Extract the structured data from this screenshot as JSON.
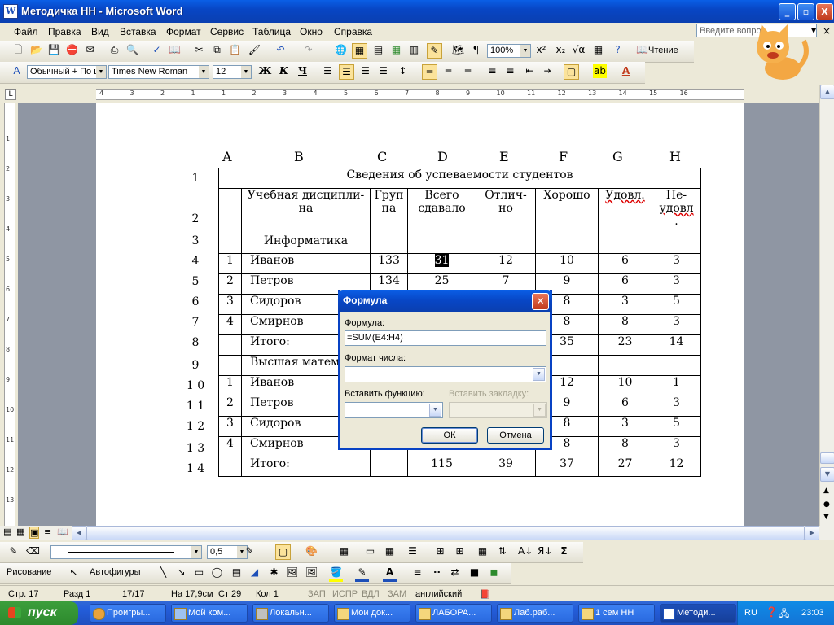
{
  "window": {
    "title": "Методичка НН - Microsoft Word",
    "min": "_",
    "max": "▫",
    "close": "X"
  },
  "menu": [
    "Файл",
    "Правка",
    "Вид",
    "Вставка",
    "Формат",
    "Сервис",
    "Таблица",
    "Окно",
    "Справка"
  ],
  "ask_placeholder": "Введите вопрос",
  "toolbar1": {
    "zoom": "100%",
    "reading_label": "Чтение"
  },
  "toolbar2": {
    "style": "Обычный + По ц",
    "font": "Times New Roman",
    "size": "12",
    "bold": "Ж",
    "italic": "К",
    "underline": "Ч"
  },
  "ruler_numbers": [
    "4",
    "3",
    "2",
    "1",
    "1",
    "2",
    "3",
    "4",
    "5",
    "6",
    "7",
    "8",
    "9",
    "10",
    "11",
    "12",
    "13",
    "14",
    "15",
    "16"
  ],
  "vruler_numbers": [
    "1",
    "2",
    "3",
    "4",
    "5",
    "6",
    "7",
    "8",
    "9",
    "10",
    "11",
    "12",
    "13"
  ],
  "columns": [
    "A",
    "B",
    "C",
    "D",
    "E",
    "F",
    "G",
    "H"
  ],
  "row_numbers": [
    "1",
    "2",
    "3",
    "4",
    "5",
    "6",
    "7",
    "8",
    "9",
    "1 0",
    "1 1",
    "1 2",
    "1 3",
    "1 4"
  ],
  "table": {
    "title": "Сведения об успеваемости студентов",
    "headers": [
      "Учебная дисципли-на",
      "Груп-па",
      "Всего сдавало",
      "Отлич-но",
      "Хорошо",
      "Удовл.",
      "Не-удовл."
    ],
    "header_lines": {
      "b": [
        "Учебная дисципли-",
        "на"
      ],
      "c": [
        "Груп",
        "па"
      ],
      "d": [
        "Всего",
        "сдавало"
      ],
      "e": [
        "Отлич-",
        "но"
      ],
      "f": [
        "Хорошо"
      ],
      "g": [
        "Удовл."
      ],
      "h": [
        "Не-",
        "удовл",
        "."
      ]
    },
    "section1": "Информатика",
    "section2": "Высшая матема",
    "total_label": "Итого:",
    "rows1": [
      [
        "1",
        "Иванов",
        "133",
        "31",
        "12",
        "10",
        "6",
        "3"
      ],
      [
        "2",
        "Петров",
        "134",
        "25",
        "7",
        "9",
        "6",
        "3"
      ],
      [
        "3",
        "Сидоров",
        "",
        "",
        "",
        "8",
        "3",
        "5"
      ],
      [
        "4",
        "Смирнов",
        "",
        "",
        "",
        "8",
        "8",
        "3"
      ]
    ],
    "total1": [
      "",
      "",
      "",
      "35",
      "23",
      "14"
    ],
    "rows2": [
      [
        "1",
        "Иванов",
        "",
        "",
        "",
        "12",
        "10",
        "1"
      ],
      [
        "2",
        "Петров",
        "",
        "",
        "",
        "9",
        "6",
        "3"
      ],
      [
        "3",
        "Сидоров",
        "",
        "",
        "",
        "8",
        "3",
        "5"
      ],
      [
        "4",
        "Смирнов",
        "",
        "",
        "",
        "8",
        "8",
        "3"
      ]
    ],
    "total2": [
      "",
      "115",
      "39",
      "37",
      "27",
      "12"
    ]
  },
  "dialog": {
    "title": "Формула",
    "formula_label": "Формула:",
    "formula_value": "=SUM(E4:H4)",
    "number_format_label": "Формат числа:",
    "insert_function_label": "Вставить функцию:",
    "insert_bookmark_label": "Вставить закладку:",
    "ok": "ОК",
    "cancel": "Отмена"
  },
  "drawing_toolbar": {
    "line_width": "0,5",
    "drawing": "Рисование",
    "autoshapes": "Автофигуры"
  },
  "status": {
    "page": "Стр. 17",
    "section": "Разд 1",
    "pages": "17/17",
    "at": "На 17,9см",
    "line": "Ст 29",
    "col": "Кол 1",
    "rec": "ЗАП",
    "trk": "ИСПР",
    "ext": "ВДЛ",
    "ovr": "ЗАМ",
    "lang": "английский"
  },
  "taskbar": {
    "start": "пуск",
    "items": [
      "Проигры...",
      "Мой ком...",
      "Локальн...",
      "Мои док...",
      "ЛАБОРА...",
      "Лаб.раб...",
      "1 сем НН",
      "Методи..."
    ],
    "lang": "RU",
    "clock": "23:03"
  },
  "colors": {
    "xp_blue": "#0846c5",
    "start_green": "#2d8a2d",
    "close_red": "#c13a1c"
  }
}
